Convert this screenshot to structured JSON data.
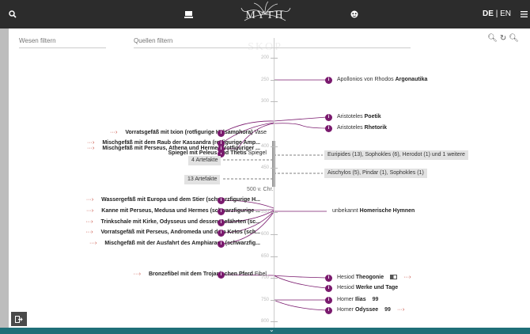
{
  "header": {
    "logo_text": "MYTH SKOP",
    "lang_active": "DE",
    "lang_separator": "|",
    "lang_other": "EN",
    "icons": [
      "search-icon",
      "book-icon",
      "tentacles-logo",
      "mask-icon",
      "menu-icon"
    ]
  },
  "filters": {
    "wesen_placeholder": "Wesen filtern",
    "quellen_placeholder": "Quellen filtern"
  },
  "axis_labels": [
    "200",
    "250",
    "300",
    "400",
    "450",
    "500 v. Chr.",
    "550",
    "600",
    "650",
    "700",
    "750",
    "800"
  ],
  "artifacts": [
    {
      "bold": "Vorratsgefäß mit Ixion (rotfigurige Halsamphora)",
      "type": "Vase",
      "arrow": true
    },
    {
      "bold": "Mischgefäß mit dem Raub der Kassandra (rotfigurige Amp...",
      "type": "",
      "arrow": true
    },
    {
      "bold": "Spiegel mit Peleus und Thetis",
      "type": "Spiegel",
      "arrow": false
    },
    {
      "bold": "Mischgefäß mit Perseus, Athena und Hermes (rotfiguriger ...",
      "type": "",
      "arrow": true
    },
    {
      "bold": "Wassergefäß mit Europa und dem Stier (schwarzfigurige H...",
      "type": "",
      "arrow": true
    },
    {
      "bold": "Kanne mit Perseus, Medusa und Hermes (schwarzfigurige ...",
      "type": "",
      "arrow": true
    },
    {
      "bold": "Trinkschale mit Kirke, Odysseus und dessen Gefährten (sc...",
      "type": "",
      "arrow": true
    },
    {
      "bold": "Vorratsgefäß mit Perseus, Andromeda und dem Ketos (sch...",
      "type": "",
      "arrow": true
    },
    {
      "bold": "Mischgefäß mit der Ausfahrt des Amphiaraos (schwarzfig...",
      "type": "",
      "arrow": true
    },
    {
      "bold": "Bronzefibel mit dem Trojanischen Pferd",
      "type": "Fibel",
      "arrow": true
    }
  ],
  "artifact_groups": [
    "4 Artefakte",
    "13 Artefakte"
  ],
  "source_groups": [
    "Euripides (13), Sophokles (6), Herodot (1) und 1 weitere",
    "Aischylos (5), Pindar (1), Sophokles (1)"
  ],
  "sources": [
    {
      "author": "Apollonios von Rhodos",
      "work": "Argonautika",
      "extra": ""
    },
    {
      "author": "Aristoteles",
      "work": "Poetik",
      "extra": ""
    },
    {
      "author": "Aristoteles",
      "work": "Rhetorik",
      "extra": ""
    },
    {
      "author": "unbekannt",
      "work": "Homerische Hymnen",
      "extra": ""
    },
    {
      "author": "Hesiod",
      "work": "Theogonie",
      "extra": "book"
    },
    {
      "author": "Hesiod",
      "work": "Werke und Tage",
      "extra": ""
    },
    {
      "author": "Homer",
      "work": "Ilias",
      "extra": "quote"
    },
    {
      "author": "Homer",
      "work": "Odyssee",
      "extra": "quote"
    }
  ],
  "glyphs": {
    "arrow": "···›",
    "quote": "99",
    "info": "i",
    "chevron_down": "⌄"
  },
  "colors": {
    "accent": "#7a1a6e",
    "topbar": "#2c2c2c",
    "bottombar": "#1f6f78",
    "arrow": "#c0392b"
  }
}
